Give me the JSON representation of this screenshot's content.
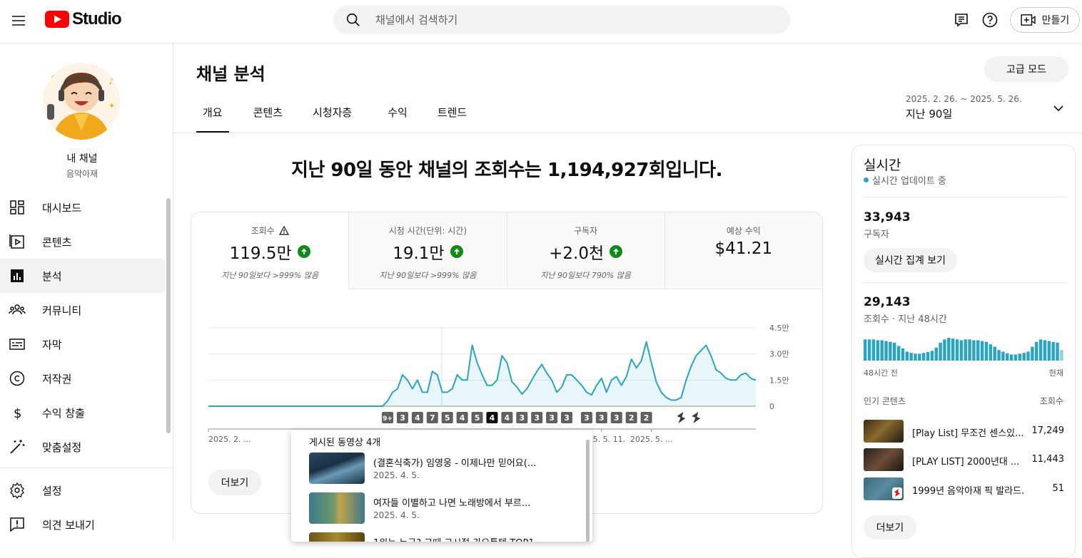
{
  "header": {
    "logo_text": "Studio",
    "search_placeholder": "채널에서 검색하기",
    "create_label": "만들기"
  },
  "sidebar": {
    "channel_name": "내 채널",
    "channel_sub": "음악아재",
    "items": [
      {
        "label": "대시보드",
        "icon": "dashboard-icon"
      },
      {
        "label": "콘텐츠",
        "icon": "content-icon"
      },
      {
        "label": "분석",
        "icon": "analytics-icon",
        "active": true
      },
      {
        "label": "커뮤니티",
        "icon": "community-icon"
      },
      {
        "label": "자막",
        "icon": "subtitles-icon"
      },
      {
        "label": "저작권",
        "icon": "copyright-icon"
      },
      {
        "label": "수익 창출",
        "icon": "monetization-icon"
      },
      {
        "label": "맞춤설정",
        "icon": "customization-icon"
      }
    ],
    "bottom_items": [
      {
        "label": "설정",
        "icon": "settings-icon"
      },
      {
        "label": "의견 보내기",
        "icon": "feedback-icon"
      }
    ]
  },
  "main": {
    "title": "채널 분석",
    "advanced_mode": "고급 모드",
    "tabs": [
      "개요",
      "콘텐츠",
      "시청자층",
      "수익",
      "트렌드"
    ],
    "active_tab": 0,
    "date_range": "2025. 2. 26. ~ 2025. 5. 26.",
    "date_period": "지난 90일",
    "headline": "지난 90일 동안 채널의 조회수는 1,194,927회입니다.",
    "metrics": [
      {
        "label": "조회수",
        "value": "119.5만",
        "note": "지난 90일보다 >999% 많음",
        "up": true,
        "warn": true
      },
      {
        "label": "시청 시간(단위: 시간)",
        "value": "19.1만",
        "note": "지난 90일보다 >999% 많음",
        "up": true
      },
      {
        "label": "구독자",
        "value": "+2.0천",
        "note": "지난 90일보다 790% 많음",
        "up": true
      },
      {
        "label": "예상 수익",
        "value": "$41.21",
        "note": ""
      }
    ],
    "more_label": "더보기"
  },
  "chart_data": {
    "type": "area",
    "ylim": [
      0,
      45000
    ],
    "y_ticks": [
      "0",
      "1.5만",
      "3.0만",
      "4.5만"
    ],
    "y_tick_values": [
      0,
      15000,
      30000,
      45000
    ],
    "x_tick_labels": [
      "2025. 2. ...",
      "2025. 5. 11.",
      "2025. 5. ..."
    ],
    "x_tick_positions": [
      0,
      79,
      89
    ],
    "color": "#2aa5c1",
    "values": [
      0,
      0,
      0,
      0,
      0,
      0,
      0,
      0,
      0,
      0,
      0,
      0,
      0,
      0,
      0,
      0,
      0,
      0,
      0,
      0,
      0,
      0,
      0,
      0,
      0,
      0,
      0,
      0,
      0,
      0,
      0,
      0,
      0,
      0,
      0,
      0,
      3000,
      8000,
      10000,
      18000,
      15000,
      10000,
      15000,
      8000,
      8000,
      20000,
      18000,
      8000,
      8000,
      10000,
      18000,
      15000,
      15000,
      35000,
      25000,
      18000,
      12000,
      12000,
      15000,
      29000,
      25000,
      14000,
      11000,
      7000,
      10000,
      15000,
      20000,
      24000,
      19000,
      15000,
      8000,
      11000,
      18000,
      18000,
      15000,
      12000,
      8000,
      6500,
      12000,
      16000,
      8000,
      15000,
      17000,
      12000,
      17000,
      27000,
      22000,
      26000,
      37000,
      25000,
      14000,
      8000,
      5000,
      3500,
      3500,
      5000,
      15000,
      23000,
      29000,
      32000,
      35000,
      29000,
      21000,
      19000,
      16000,
      15000,
      15000,
      18000,
      19000,
      16000,
      15000
    ],
    "markers": [
      {
        "x": 36,
        "label": "9+"
      },
      {
        "x": 39,
        "label": "3"
      },
      {
        "x": 42,
        "label": "4"
      },
      {
        "x": 45,
        "label": "7"
      },
      {
        "x": 48,
        "label": "5"
      },
      {
        "x": 51,
        "label": "4"
      },
      {
        "x": 54,
        "label": "5"
      },
      {
        "x": 57,
        "label": "4",
        "active": true
      },
      {
        "x": 60,
        "label": "4"
      },
      {
        "x": 63,
        "label": "3"
      },
      {
        "x": 66,
        "label": "3"
      },
      {
        "x": 69,
        "label": "3"
      },
      {
        "x": 72,
        "label": "3"
      },
      {
        "x": 76,
        "label": "3"
      },
      {
        "x": 79,
        "label": "3"
      },
      {
        "x": 82,
        "label": "3"
      },
      {
        "x": 85,
        "label": "2"
      },
      {
        "x": 88,
        "label": "2"
      }
    ],
    "shorts_markers": [
      95,
      98
    ]
  },
  "popup": {
    "title": "게시된 동영상 4개",
    "items": [
      {
        "title": "(결혼식축가) 임영웅 - 이제나만 믿어요(...",
        "date": "2025. 4. 5."
      },
      {
        "title": "여자들 이별하고 나면 노래방에서 부르...",
        "date": "2025. 4. 5."
      },
      {
        "title": "1위는 누구? 그때 그시절 가요톱텐 TOP1...",
        "date": ""
      }
    ]
  },
  "realtime": {
    "title": "실시간",
    "status": "실시간 업데이트 중",
    "subscribers": "33,943",
    "subscribers_label": "구독자",
    "detail_button": "실시간 집계 보기",
    "views": "29,143",
    "views_label": "조회수 · 지난 48시간",
    "axis_left": "48시간 전",
    "axis_right": "현재",
    "hourly_views": [
      52,
      52,
      52,
      50,
      50,
      48,
      46,
      44,
      36,
      30,
      22,
      19,
      17,
      17,
      19,
      21,
      24,
      32,
      44,
      52,
      56,
      54,
      52,
      50,
      52,
      52,
      50,
      50,
      48,
      46,
      40,
      34,
      26,
      22,
      18,
      15,
      15,
      17,
      19,
      22,
      34,
      46,
      52,
      50,
      48,
      46,
      44,
      26
    ],
    "top_content_label": "인기 콘텐츠",
    "views_col_label": "조회수",
    "top_content": [
      {
        "title": "[Play List] 무조건 센스있...",
        "views": "17,249"
      },
      {
        "title": "[PLAY LIST] 2000년대 ...",
        "views": "11,443"
      },
      {
        "title": "1999년 음악아재 픽 발라드...",
        "views": "51"
      }
    ],
    "more_label": "더보기"
  }
}
